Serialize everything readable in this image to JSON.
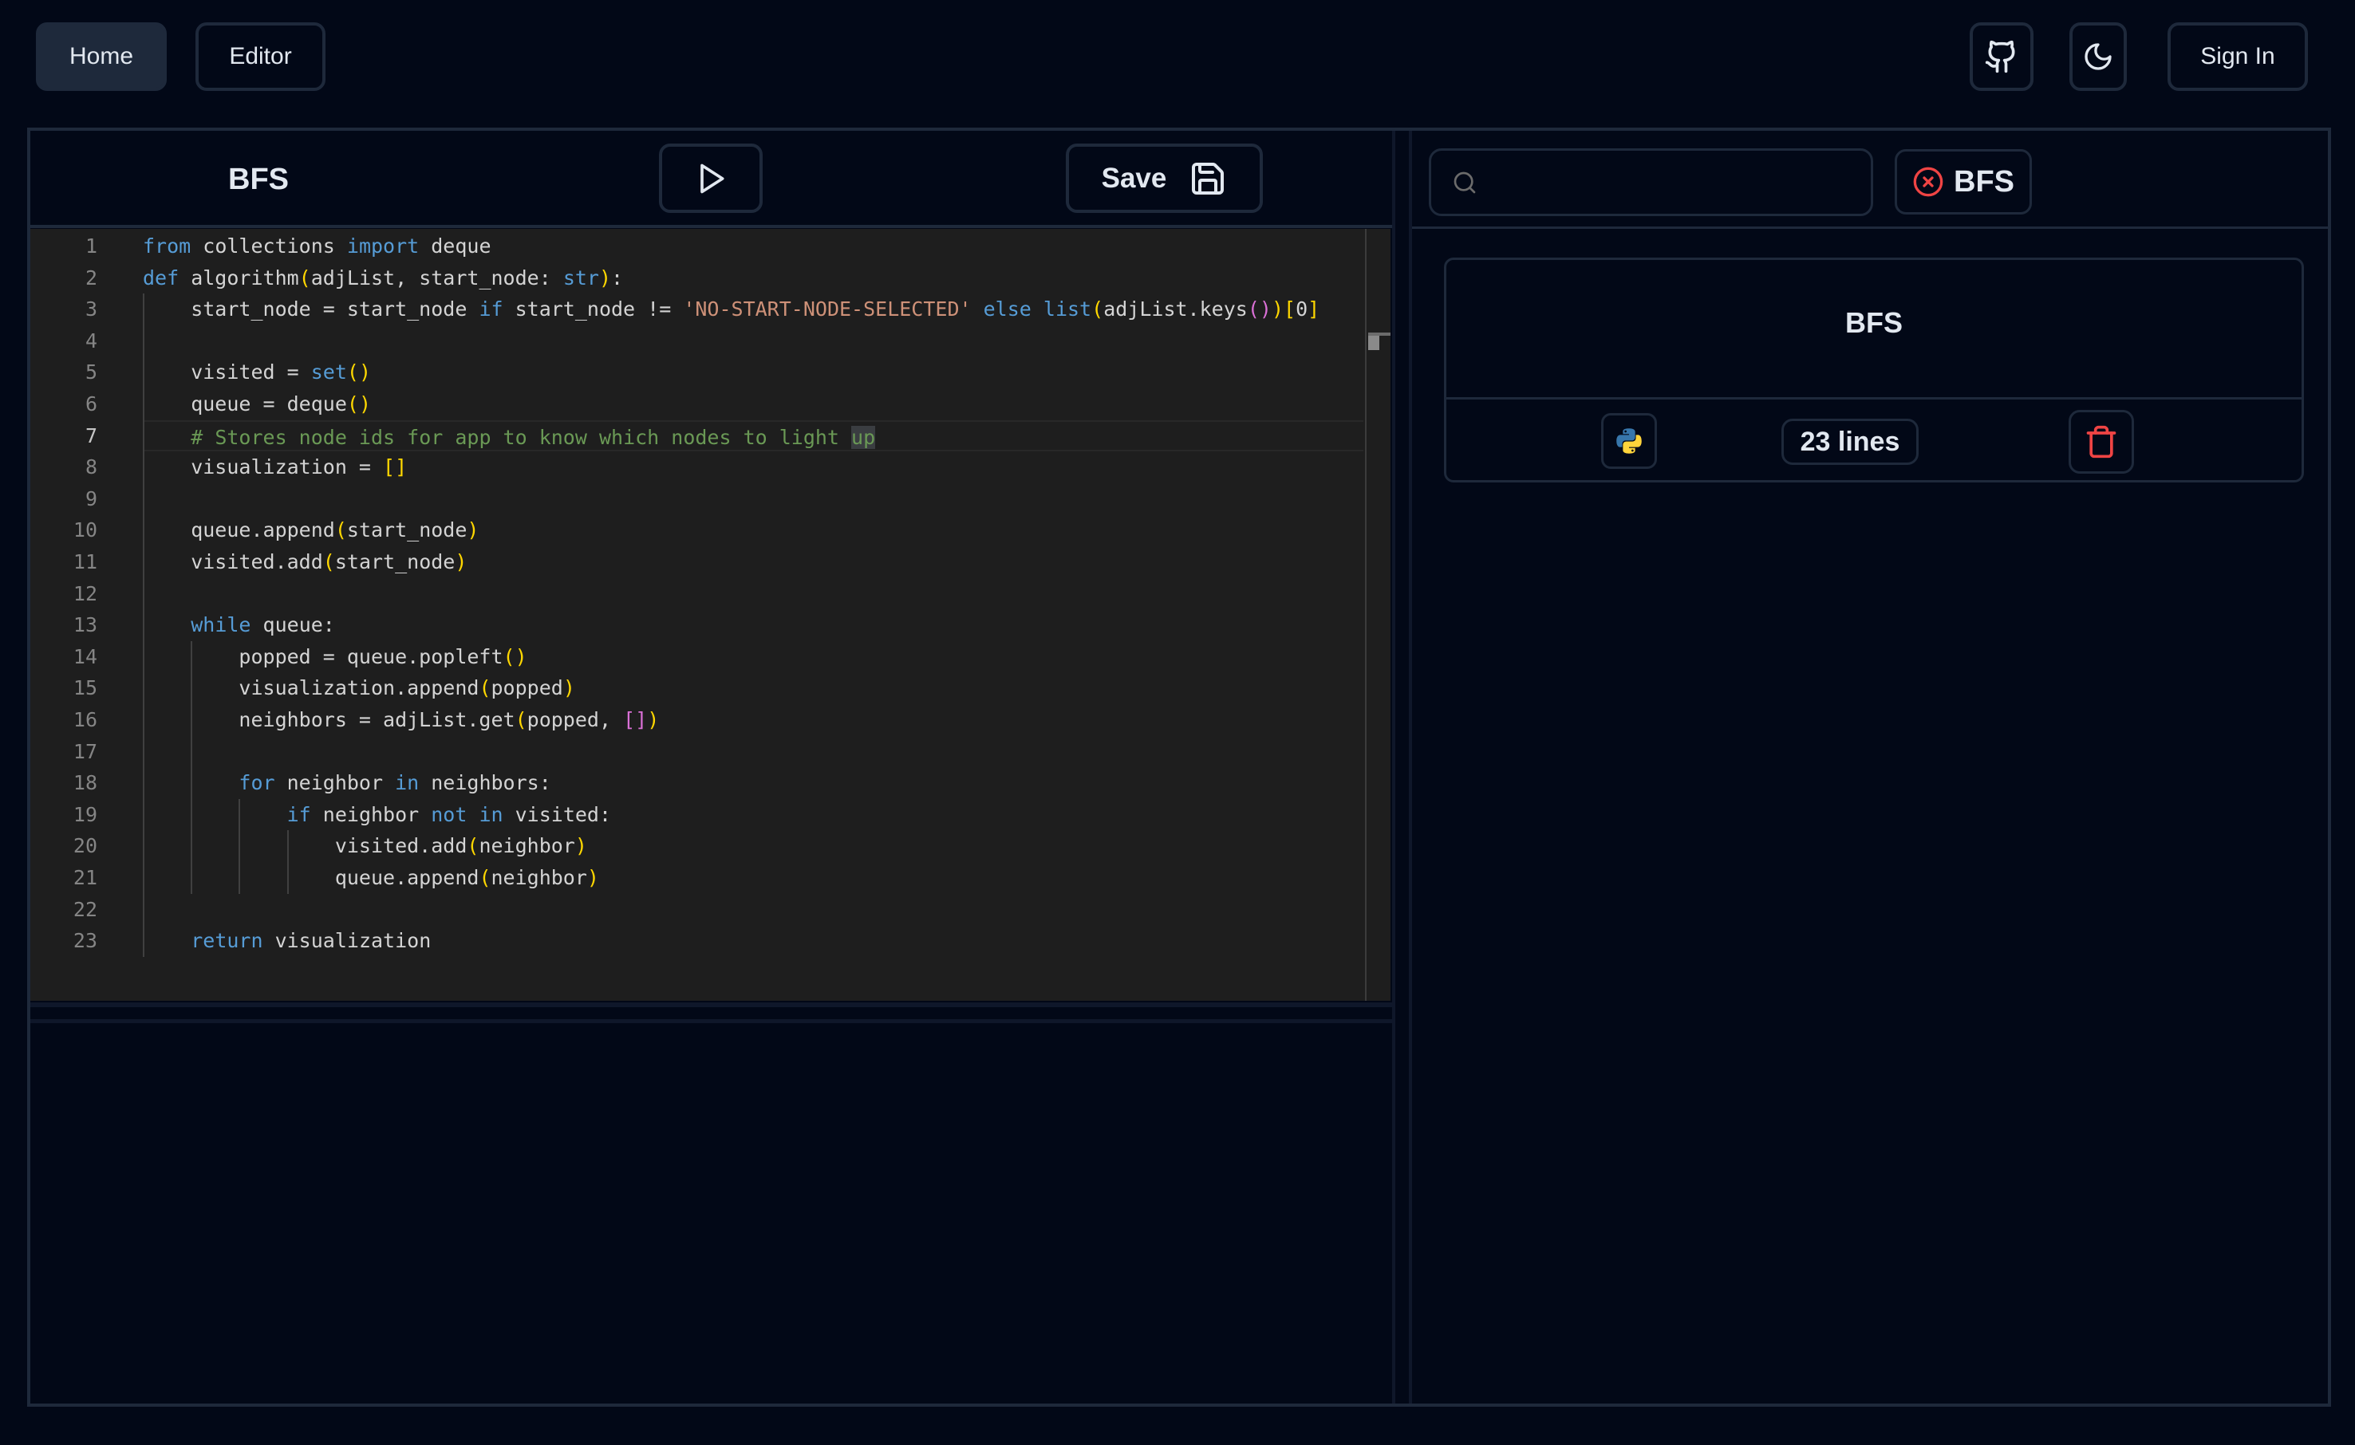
{
  "nav": {
    "home_label": "Home",
    "editor_label": "Editor",
    "github_icon": "github-icon",
    "theme_icon": "moon-icon",
    "signin_label": "Sign In"
  },
  "editor_panel": {
    "algorithm_title": "BFS",
    "run_icon": "play-icon",
    "save_label": "Save",
    "save_icon": "floppy-disk-icon",
    "active_line": 7,
    "line_numbers": [
      "1",
      "2",
      "3",
      "4",
      "5",
      "6",
      "7",
      "8",
      "9",
      "10",
      "11",
      "12",
      "13",
      "14",
      "15",
      "16",
      "17",
      "18",
      "19",
      "20",
      "21",
      "22",
      "23"
    ],
    "code_lines": [
      "from collections import deque",
      "def algorithm(adjList, start_node: str):",
      "    start_node = start_node if start_node != 'NO-START-NODE-SELECTED' else list(adjList.keys())[0]",
      "",
      "    visited = set()",
      "    queue = deque()",
      "    # Stores node ids for app to know which nodes to light up",
      "    visualization = []",
      "",
      "    queue.append(start_node)",
      "    visited.add(start_node)",
      "",
      "    while queue:",
      "        popped = queue.popleft()",
      "        visualization.append(popped)",
      "        neighbors = adjList.get(popped, [])",
      "",
      "        for neighbor in neighbors:",
      "            if neighbor not in visited:",
      "                visited.add(neighbor)",
      "                queue.append(neighbor)",
      "",
      "    return visualization"
    ],
    "syntax_colors": {
      "keyword": "#569cd6",
      "string": "#ce9178",
      "comment": "#6a9955",
      "bracket_level1": "#ffd700",
      "bracket_level2": "#da70d6",
      "text": "#d4d4d4"
    }
  },
  "library_panel": {
    "search": {
      "value": "",
      "placeholder": ""
    },
    "active_filter": {
      "label": "BFS",
      "icon": "x-circle-icon"
    },
    "cards": [
      {
        "title": "BFS",
        "language": "Python",
        "language_icon": "python-logo-icon",
        "lines_label": "23 lines",
        "delete_icon": "trash-icon"
      }
    ]
  },
  "colors": {
    "background": "#020817",
    "border": "#1e293b",
    "editor_bg": "#1e1e1e",
    "text": "#e2e8f0",
    "danger": "#ef4444"
  }
}
